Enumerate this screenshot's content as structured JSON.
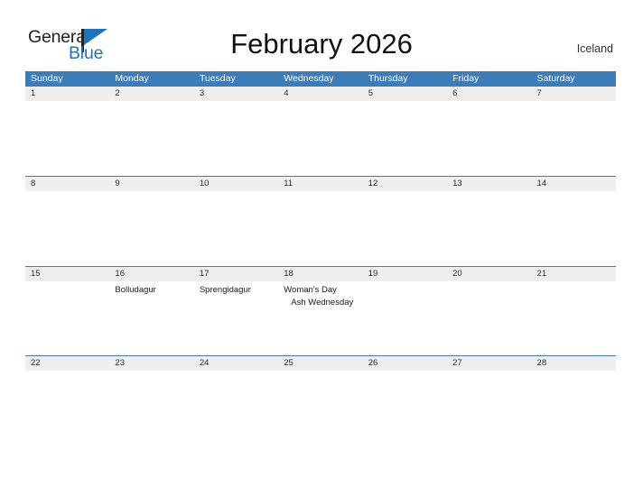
{
  "brand": {
    "name_part1": "General",
    "name_part2": "Blue",
    "flag_icon": "flag-triangle-icon"
  },
  "header": {
    "title": "February 2026",
    "country": "Iceland"
  },
  "colors": {
    "header_blue": "#3c7cb8",
    "band_gray": "#efefef",
    "logo_blue": "#1c75bc",
    "logo_dark": "#231f20"
  },
  "calendar": {
    "day_names": [
      "Sunday",
      "Monday",
      "Tuesday",
      "Wednesday",
      "Thursday",
      "Friday",
      "Saturday"
    ],
    "weeks": [
      {
        "days": [
          {
            "num": "1",
            "events": []
          },
          {
            "num": "2",
            "events": []
          },
          {
            "num": "3",
            "events": []
          },
          {
            "num": "4",
            "events": []
          },
          {
            "num": "5",
            "events": []
          },
          {
            "num": "6",
            "events": []
          },
          {
            "num": "7",
            "events": []
          }
        ]
      },
      {
        "days": [
          {
            "num": "8",
            "events": []
          },
          {
            "num": "9",
            "events": []
          },
          {
            "num": "10",
            "events": []
          },
          {
            "num": "11",
            "events": []
          },
          {
            "num": "12",
            "events": []
          },
          {
            "num": "13",
            "events": []
          },
          {
            "num": "14",
            "events": []
          }
        ]
      },
      {
        "days": [
          {
            "num": "15",
            "events": []
          },
          {
            "num": "16",
            "events": [
              {
                "label": "Bolludagur",
                "indent": false
              }
            ]
          },
          {
            "num": "17",
            "events": [
              {
                "label": "Sprengidagur",
                "indent": false
              }
            ]
          },
          {
            "num": "18",
            "events": [
              {
                "label": "Woman's Day",
                "indent": false
              },
              {
                "label": "Ash Wednesday",
                "indent": true
              }
            ]
          },
          {
            "num": "19",
            "events": []
          },
          {
            "num": "20",
            "events": []
          },
          {
            "num": "21",
            "events": []
          }
        ]
      },
      {
        "days": [
          {
            "num": "22",
            "events": []
          },
          {
            "num": "23",
            "events": []
          },
          {
            "num": "24",
            "events": []
          },
          {
            "num": "25",
            "events": []
          },
          {
            "num": "26",
            "events": []
          },
          {
            "num": "27",
            "events": []
          },
          {
            "num": "28",
            "events": []
          }
        ]
      }
    ]
  }
}
